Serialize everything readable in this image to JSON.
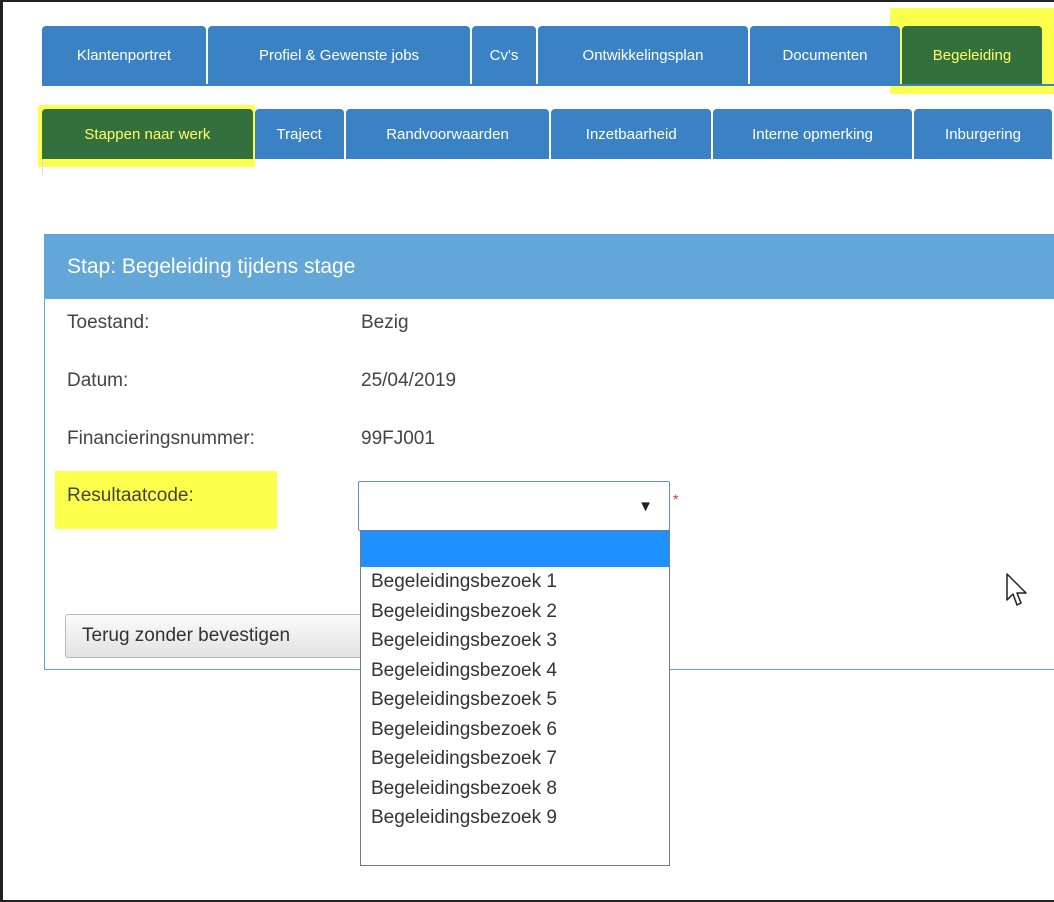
{
  "tabs_primary": [
    {
      "label": "Klantenportret",
      "active": false
    },
    {
      "label": "Profiel & Gewenste jobs",
      "active": false
    },
    {
      "label": "Cv's",
      "active": false
    },
    {
      "label": "Ontwikkelingsplan",
      "active": false
    },
    {
      "label": "Documenten",
      "active": false
    },
    {
      "label": "Begeleiding",
      "active": true
    }
  ],
  "tabs_secondary": [
    {
      "label": "Stappen naar werk",
      "active": true
    },
    {
      "label": "Traject",
      "active": false
    },
    {
      "label": "Randvoorwaarden",
      "active": false
    },
    {
      "label": "Inzetbaarheid",
      "active": false
    },
    {
      "label": "Interne opmerking",
      "active": false
    },
    {
      "label": "Inburgering",
      "active": false
    }
  ],
  "step": {
    "title": "Stap: Begeleiding tijdens stage",
    "fields": [
      {
        "label": "Toestand:",
        "value": "Bezig"
      },
      {
        "label": "Datum:",
        "value": "25/04/2019"
      },
      {
        "label": "Financieringsnummer:",
        "value": "99FJ001"
      }
    ],
    "result_label": "Resultaatcode:",
    "result_value": "",
    "required_marker": "*",
    "back_button": "Terug zonder bevestigen"
  },
  "dropdown_options": [
    "",
    "Begeleidingsbezoek 1",
    "Begeleidingsbezoek 2",
    "Begeleidingsbezoek 3",
    "Begeleidingsbezoek 4",
    "Begeleidingsbezoek 5",
    "Begeleidingsbezoek 6",
    "Begeleidingsbezoek 7",
    "Begeleidingsbezoek 8",
    "Begeleidingsbezoek 9"
  ],
  "icons": {
    "caret": "caret-down-icon",
    "pointer": "mouse-pointer-icon"
  },
  "colors": {
    "tab_blue": "#3a82c4",
    "tab_active_green": "#34703e",
    "active_text": "#ffff66",
    "highlight_yellow": "#fdff4d",
    "panel_header": "#63a6d8",
    "selected_option": "#1e90ff"
  }
}
